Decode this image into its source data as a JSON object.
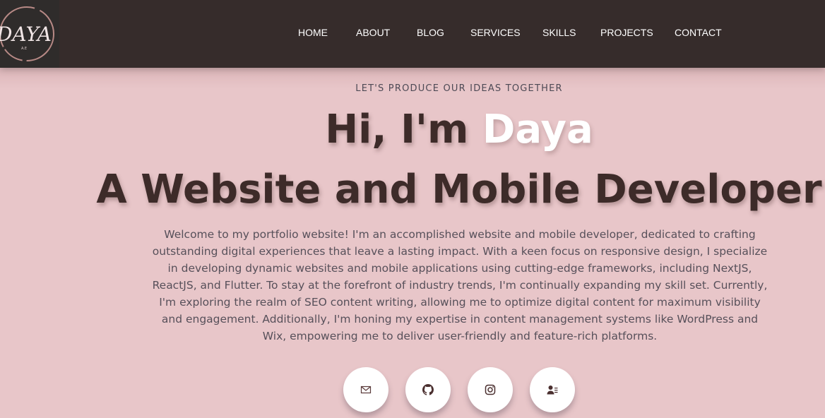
{
  "logo": {
    "text": "DAYA",
    "subtext": "A.E"
  },
  "nav": {
    "items": [
      {
        "label": "HOME"
      },
      {
        "label": "ABOUT"
      },
      {
        "label": "BLOG"
      },
      {
        "label": "SERVICES"
      },
      {
        "label": "SKILLS"
      },
      {
        "label": "PROJECTS"
      },
      {
        "label": "CONTACT"
      }
    ]
  },
  "hero": {
    "tagline": "LET'S PRODUCE OUR IDEAS TOGETHER",
    "greeting_prefix": "Hi, I'm ",
    "name": "Daya",
    "role": "A Website and Mobile Developer",
    "bio": "Welcome to my portfolio website! I'm an accomplished website and mobile developer, dedicated to crafting outstanding digital experiences that leave a lasting impact. With a keen focus on responsive design, I specialize in developing dynamic websites and mobile applications using cutting-edge frameworks, including NextJS, ReactJS, and Flutter. To stay at the forefront of industry trends, I'm continually expanding my skill set. Currently, I'm exploring the realm of SEO content writing, allowing me to optimize digital content for maximum visibility and engagement. Additionally, I'm honing my expertise in content management systems like WordPress and Wix, empowering me to deliver user-friendly and feature-rich platforms."
  },
  "socials": [
    {
      "icon": "envelope-icon",
      "label": "Email"
    },
    {
      "icon": "github-icon",
      "label": "GitHub"
    },
    {
      "icon": "instagram-icon",
      "label": "Instagram"
    },
    {
      "icon": "contact-card-icon",
      "label": "Resume"
    }
  ],
  "colors": {
    "nav_bg": "#362c2b",
    "hero_bg": "#e8c6c9",
    "heading": "#3d2b29",
    "accent_name": "#ffffff",
    "body_text": "#57505a",
    "icon": "#5a3a3a"
  }
}
